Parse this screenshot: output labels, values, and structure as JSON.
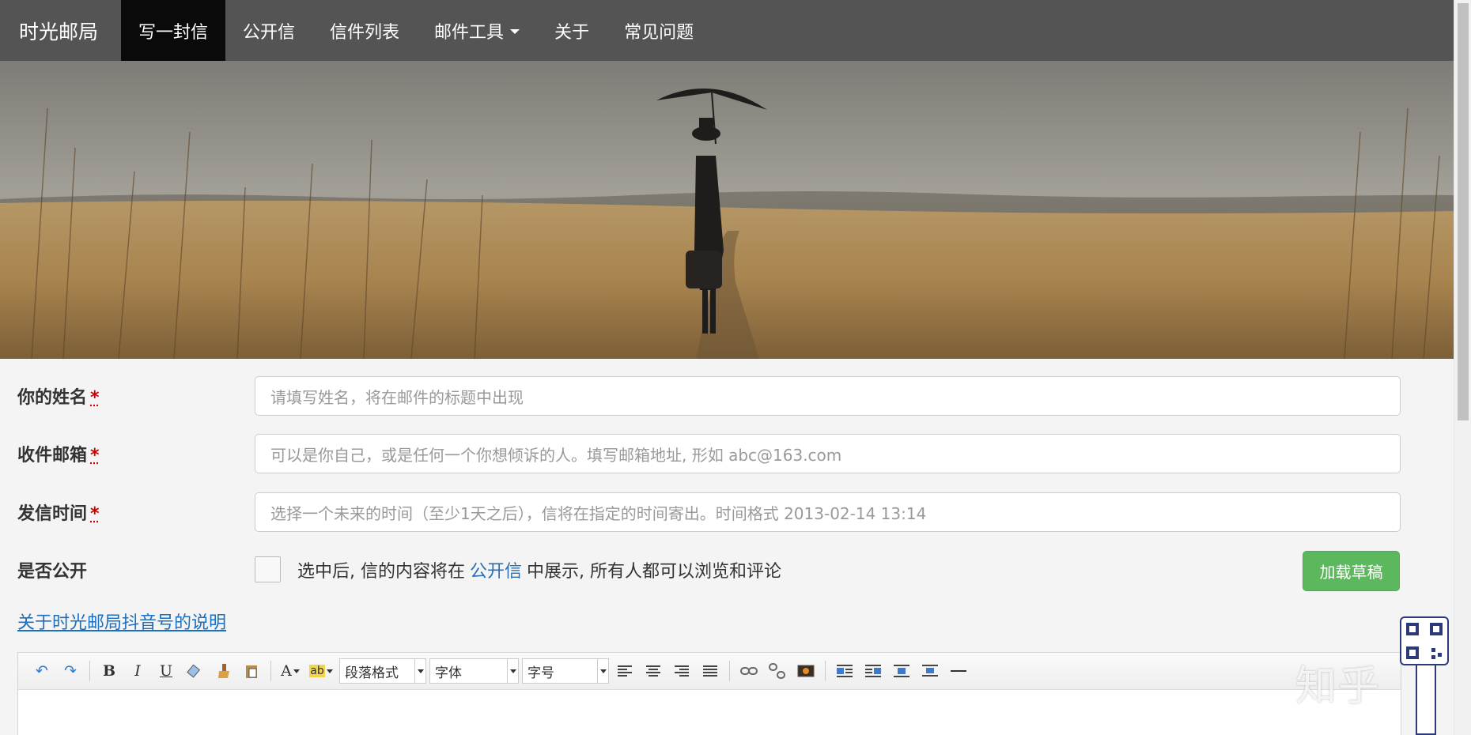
{
  "nav": {
    "brand": "时光邮局",
    "items": [
      {
        "label": "写一封信",
        "active": true
      },
      {
        "label": "公开信"
      },
      {
        "label": "信件列表"
      },
      {
        "label": "邮件工具",
        "dropdown": true
      },
      {
        "label": "关于"
      },
      {
        "label": "常见问题"
      }
    ]
  },
  "form": {
    "name": {
      "label": "你的姓名",
      "required": "*",
      "placeholder": "请填写姓名，将在邮件的标题中出现"
    },
    "email": {
      "label": "收件邮箱",
      "required": "*",
      "placeholder": "可以是你自己，或是任何一个你想倾诉的人。填写邮箱地址, 形如 abc@163.com"
    },
    "time": {
      "label": "发信时间",
      "required": "*",
      "placeholder": "选择一个未来的时间（至少1天之后），信将在指定的时间寄出。时间格式 2013-02-14 13:14"
    },
    "public": {
      "label": "是否公开",
      "text_before": "选中后, 信的内容将在",
      "link": "公开信",
      "text_after": "中展示, 所有人都可以浏览和评论"
    },
    "load_draft": "加载草稿"
  },
  "about_link": "关于时光邮局抖音号的说明",
  "editor": {
    "paragraph_format": "段落格式",
    "font": "字体",
    "font_size": "字号"
  },
  "watermark": "知乎"
}
